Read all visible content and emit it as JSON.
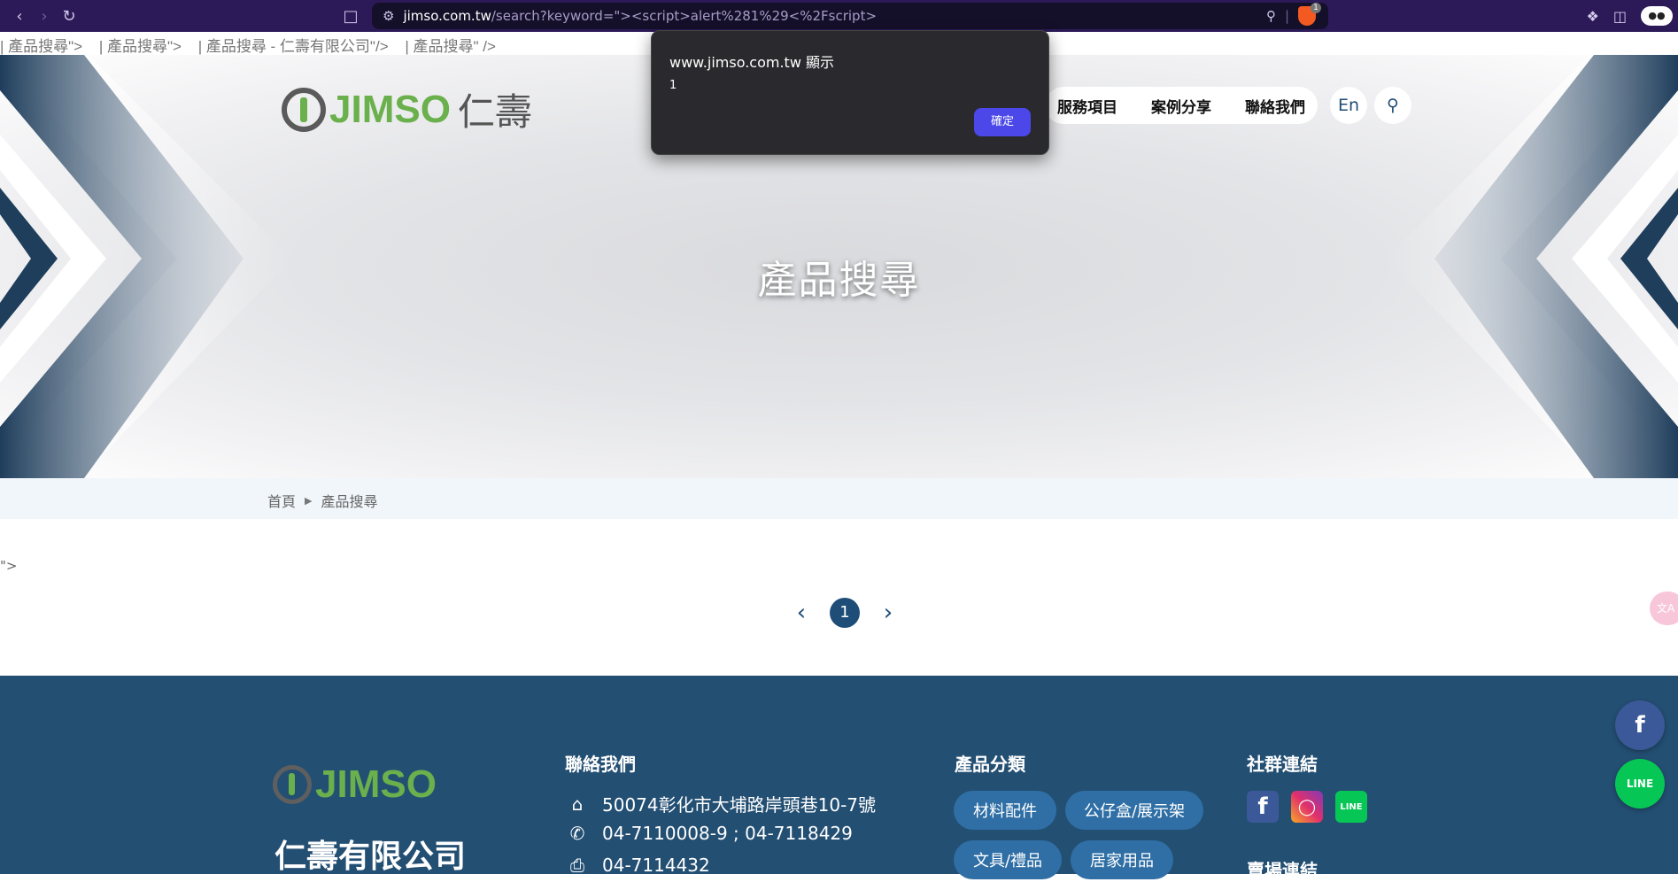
{
  "browser": {
    "url_host": "jimso.com.tw",
    "url_path": "/search?keyword=\"><script>alert%281%29<%2Fscript>",
    "profile_label": "●●"
  },
  "leaked_titles": [
    "| 產品搜尋\">",
    "| 產品搜尋\">",
    "| 產品搜尋 - 仁壽有限公司\"/>",
    "| 產品搜尋\" />"
  ],
  "header": {
    "logo_text": "JIMSO",
    "logo_cn": "仁壽",
    "nav": [
      "服務項目",
      "案例分享",
      "聯絡我們"
    ],
    "lang": "En"
  },
  "banner": {
    "title": "產品搜尋"
  },
  "dialog": {
    "title": "www.jimso.com.tw 顯示",
    "message": "1",
    "ok_label": "確定"
  },
  "breadcrumb": {
    "home": "首頁",
    "current": "產品搜尋"
  },
  "leak_quote": "\">",
  "pagination": {
    "current": "1"
  },
  "footer": {
    "logo_text": "JIMSO",
    "company": "仁壽有限公司",
    "contact_heading": "聯絡我們",
    "address": "50074彰化市大埔路岸頭巷10-7號",
    "phone": "04-7110008-9 ; 04-7118429",
    "fax": "04-7114432",
    "category_heading": "產品分類",
    "categories": [
      "材料配件",
      "公仔盒/展示架",
      "文具/禮品",
      "居家用品"
    ],
    "social_heading": "社群連結",
    "store_heading": "賣場連結"
  },
  "colors": {
    "brand_green": "#6ab04c",
    "footer_blue": "#234f73",
    "accent_blue": "#1e4d78",
    "dialog_ok": "#4b47e8"
  }
}
